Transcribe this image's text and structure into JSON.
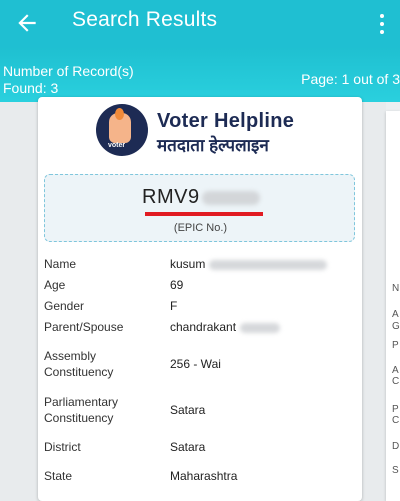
{
  "appbar": {
    "title": "Search Results"
  },
  "summary": {
    "records_label": "Number of Record(s)",
    "found": "Found: 3",
    "page": "Page: 1 out of 3"
  },
  "logo": {
    "icon_text": "voter",
    "name_en": "Voter Helpline",
    "name_hi": "मतदाता हेल्पलाइन"
  },
  "epic": {
    "number_visible": "RMV9",
    "label": "(EPIC No.)"
  },
  "details": [
    {
      "label": "Name",
      "value": "kusum"
    },
    {
      "label": "Age",
      "value": "69"
    },
    {
      "label": "Gender",
      "value": "F"
    },
    {
      "label": "Parent/Spouse",
      "value": "chandrakant"
    },
    {
      "label": "Assembly Constituency",
      "value": "256 - Wai"
    },
    {
      "label": "Parliamentary Constituency",
      "value": "Satara"
    },
    {
      "label": "District",
      "value": "Satara"
    },
    {
      "label": "State",
      "value": "Maharashtra"
    }
  ],
  "next_card_letters": [
    "N",
    "A",
    "G",
    "P",
    "A C",
    "P C",
    "D",
    "S"
  ]
}
